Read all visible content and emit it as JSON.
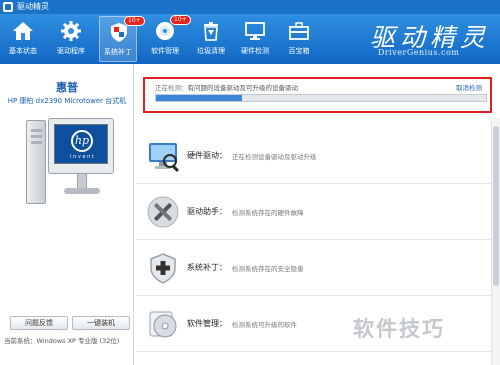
{
  "window": {
    "title": "驱动精灵"
  },
  "toolbar": {
    "items": [
      {
        "label": "基本状态",
        "icon": "home-icon",
        "active": false
      },
      {
        "label": "驱动程序",
        "icon": "gear-icon",
        "active": false
      },
      {
        "label": "系统补丁",
        "icon": "shield-icon",
        "active": true,
        "badge": "10+"
      },
      {
        "label": "软件管理",
        "icon": "disc-icon",
        "active": false,
        "badge": "10+"
      },
      {
        "label": "垃圾清理",
        "icon": "trash-icon",
        "active": false
      },
      {
        "label": "硬件检测",
        "icon": "monitor-icon",
        "active": false
      },
      {
        "label": "百宝箱",
        "icon": "toolbox-icon",
        "active": false
      }
    ]
  },
  "brand": {
    "logo_text": "驱动精灵",
    "url": "DriverGenius.com"
  },
  "left": {
    "brand_name": "惠普",
    "model": "HP 康柏 dx2390 Microtower 台式机",
    "monitor_logo": "hp",
    "monitor_caption": "i n v e n t",
    "feedback_button": "问题反馈",
    "install_button": "一键装机",
    "system_info": "当前系统：Windows XP 专业版 (32位)"
  },
  "scan": {
    "status_prefix": "正在检测：",
    "status_text": "有问题的设备驱动及可升级的设备驱动",
    "cancel_label": "取消检测",
    "progress": 0.26
  },
  "items": [
    {
      "title": "硬件驱动：",
      "desc": "正在检测设备驱动及驱动升级",
      "icon": "hardware-monitor-icon"
    },
    {
      "title": "驱动助手：",
      "desc": "检测系统存在的硬件故障",
      "icon": "tools-icon"
    },
    {
      "title": "系统补丁：",
      "desc": "检测系统存在的安全隐患",
      "icon": "shield-plus-icon"
    },
    {
      "title": "软件管理：",
      "desc": "检测系统可升级的软件",
      "icon": "software-disc-icon"
    }
  ],
  "watermark": "软件技巧",
  "colors": {
    "accent": "#1a73c8",
    "highlight": "#e02020",
    "progress": "#3a86d8"
  }
}
